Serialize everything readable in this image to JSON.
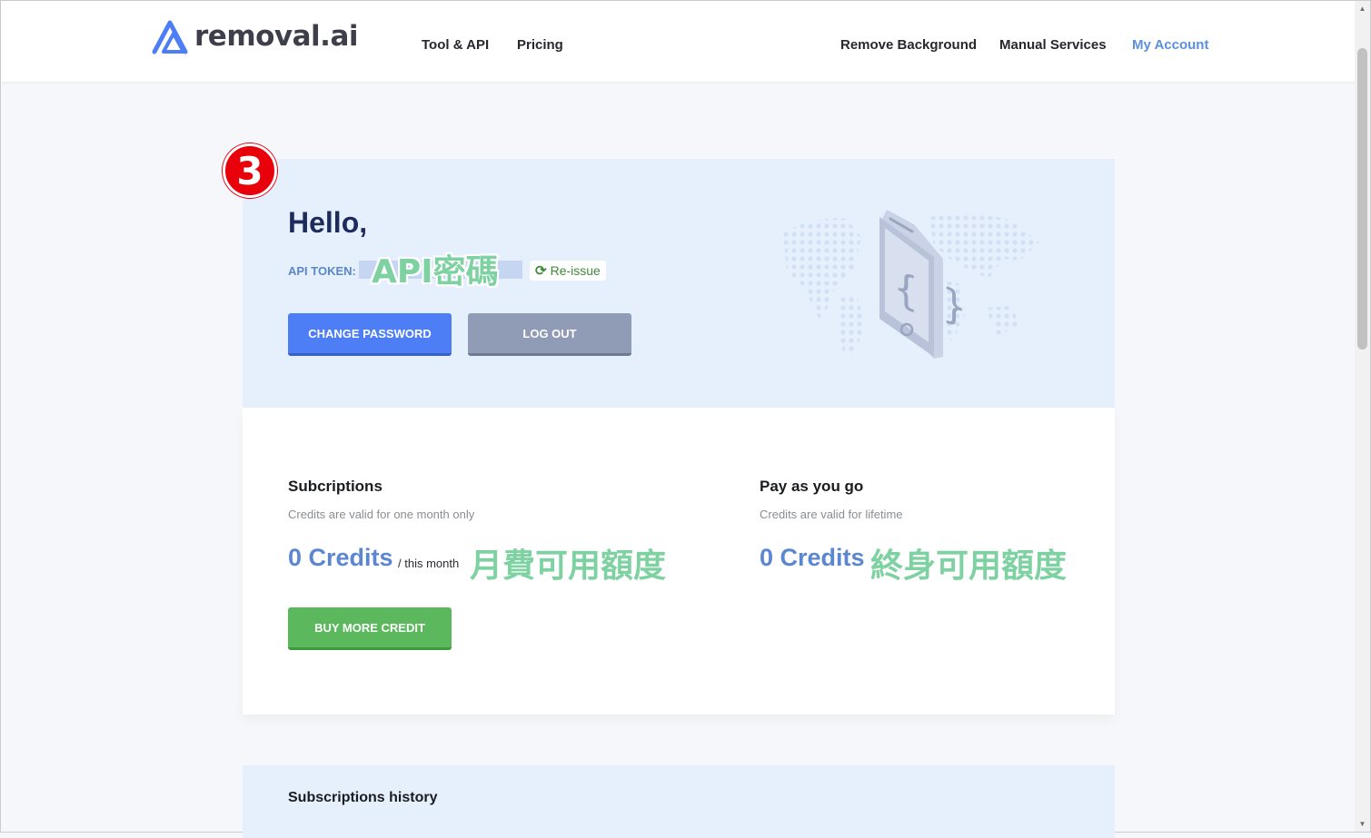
{
  "brand": {
    "name": "removal.ai",
    "color": "#4e7ef6"
  },
  "nav": {
    "left": [
      "Tool & API",
      "Pricing"
    ],
    "right": [
      "Remove Background",
      "Manual Services",
      "My Account"
    ],
    "active": "My Account"
  },
  "step_badge": "3",
  "hero": {
    "greeting": "Hello,",
    "api_token_label": "API TOKEN:",
    "api_token_annotation": "API密碼",
    "reissue_label": "Re-issue",
    "change_password_label": "CHANGE PASSWORD",
    "logout_label": "LOG OUT",
    "illustration_icon": "phone-code-icon"
  },
  "subscriptions": {
    "title": "Subcriptions",
    "subtitle": "Credits are valid for one month only",
    "credits": "0 Credits",
    "unit": "/ this month",
    "annotation": "月費可用額度",
    "buy_label": "BUY MORE CREDIT"
  },
  "payg": {
    "title": "Pay as you go",
    "subtitle": "Credits are valid for lifetime",
    "credits": "0 Credits",
    "annotation": "終身可用額度"
  },
  "history": {
    "title": "Subscriptions history"
  },
  "colors": {
    "annotation_green": "#7ed1a1",
    "badge_red": "#e8000b",
    "credit_blue": "#5b87d2",
    "hero_bg": "#e6f0fd"
  }
}
